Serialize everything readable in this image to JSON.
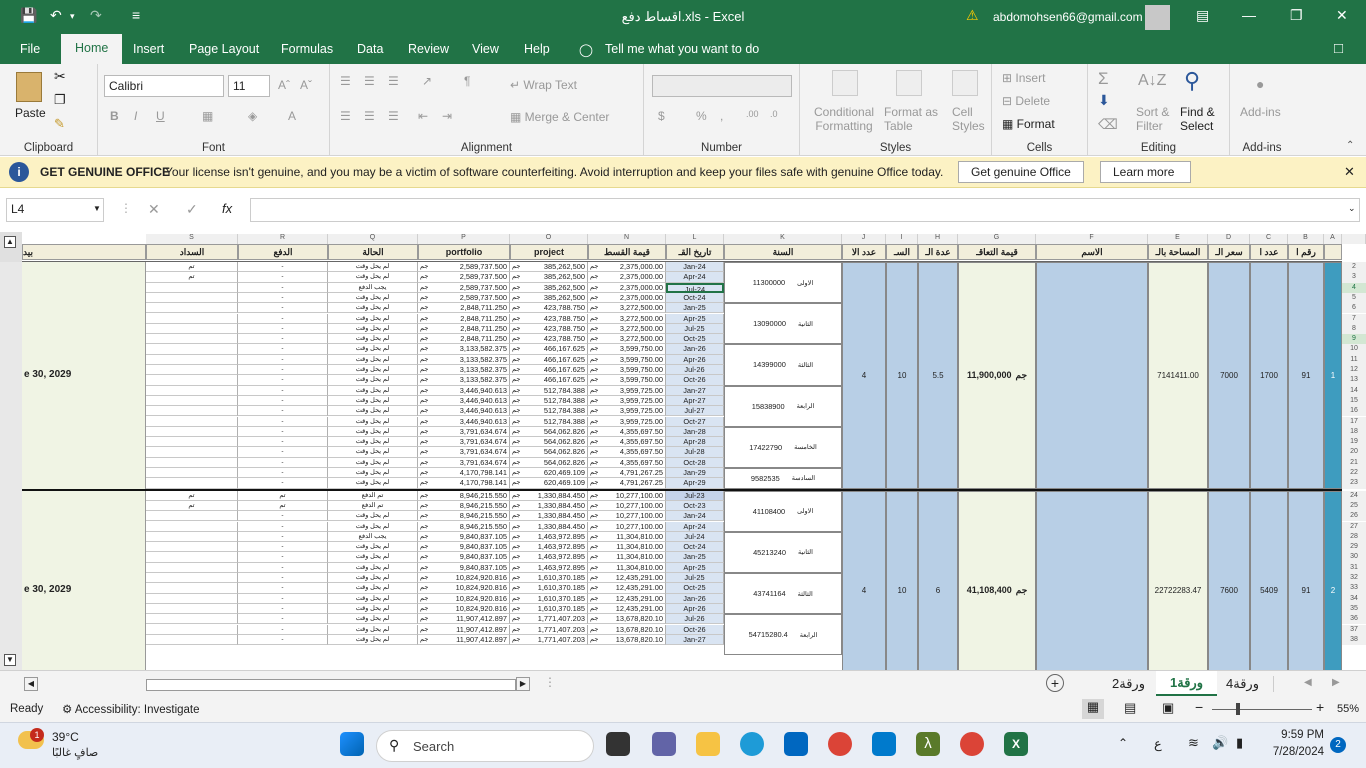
{
  "titlebar": {
    "filename": "اقساط دفع.xls",
    "app": "Excel",
    "separator": " - ",
    "account": "abdomohsen66@gmail.com"
  },
  "tabs": [
    "File",
    "Home",
    "Insert",
    "Page Layout",
    "Formulas",
    "Data",
    "Review",
    "View",
    "Help"
  ],
  "tellme": "Tell me what you want to do",
  "ribbon": {
    "clipboard": {
      "paste": "Paste",
      "label": "Clipboard"
    },
    "font": {
      "name": "Calibri",
      "size": "11",
      "label": "Font"
    },
    "alignment": {
      "wrap": "Wrap Text",
      "merge": "Merge & Center",
      "label": "Alignment"
    },
    "number": {
      "label": "Number"
    },
    "styles": {
      "cond": "Conditional",
      "cond2": "Formatting",
      "fmt": "Format as",
      "fmt2": "Table",
      "cell": "Cell",
      "cell2": "Styles",
      "label": "Styles"
    },
    "cells": {
      "insert": "Insert",
      "delete": "Delete",
      "format": "Format",
      "label": "Cells"
    },
    "editing": {
      "sort": "Sort &",
      "sort2": "Filter",
      "find": "Find &",
      "find2": "Select",
      "label": "Editing"
    },
    "addins": {
      "btn": "Add-ins",
      "label": "Add-ins"
    }
  },
  "message": {
    "title": "GET GENUINE OFFICE",
    "text": "Your license isn't genuine, and you may be a victim of software counterfeiting. Avoid interruption and keep your files safe with genuine Office today.",
    "btn1": "Get genuine Office",
    "btn2": "Learn more"
  },
  "namebox": "L4",
  "columns": [
    {
      "letter": "S",
      "header": "السداد"
    },
    {
      "letter": "R",
      "header": "الدفع"
    },
    {
      "letter": "Q",
      "header": "الحالة"
    },
    {
      "letter": "P",
      "header": "portfolio"
    },
    {
      "letter": "O",
      "header": "project"
    },
    {
      "letter": "N",
      "header": "قيمة القسط"
    },
    {
      "letter": "L",
      "header": "تاريخ القـ"
    },
    {
      "letter": "K",
      "header": "السنة"
    },
    {
      "letter": "J",
      "header": "عدد الا"
    },
    {
      "letter": "I",
      "header": "السـ"
    },
    {
      "letter": "H",
      "header": "عدة الـ"
    },
    {
      "letter": "G",
      "header": "قيمة التعاقـ"
    },
    {
      "letter": "F",
      "header": "الاسم"
    },
    {
      "letter": "E",
      "header": "المساحة بالـ"
    },
    {
      "letter": "D",
      "header": "سعر الـ"
    },
    {
      "letter": "C",
      "header": "عدد ا"
    },
    {
      "letter": "B",
      "header": "رقم ا"
    },
    {
      "letter": "A",
      "header": ""
    }
  ],
  "leftcol": {
    "header": "بيد",
    "date1": "e 30, 2029",
    "date2": "e 30, 2029"
  },
  "rows": [
    {
      "n": "2",
      "s": "تم",
      "r": "-",
      "q": "لم يحل وقت",
      "p": "2,589,737.500",
      "o": "385,262,500",
      "nn": "2,375,000.00",
      "l": "Jan-24"
    },
    {
      "n": "3",
      "s": "تم",
      "r": "-",
      "q": "لم يحل وقت",
      "p": "2,589,737.500",
      "o": "385,262,500",
      "nn": "2,375,000.00",
      "l": "Apr-24"
    },
    {
      "n": "4",
      "s": "",
      "r": "-",
      "q": "يجب الدفع",
      "p": "2,589,737.500",
      "o": "385,262,500",
      "nn": "2,375,000.00",
      "l": "Jul-24"
    },
    {
      "n": "5",
      "s": "",
      "r": "-",
      "q": "لم يحل وقت",
      "p": "2,589,737.500",
      "o": "385,262,500",
      "nn": "2,375,000.00",
      "l": "Oct-24"
    },
    {
      "n": "6",
      "s": "",
      "r": "-",
      "q": "لم يحل وقت",
      "p": "2,848,711.250",
      "o": "423,788.750",
      "nn": "3,272,500.00",
      "l": "Jan-25"
    },
    {
      "n": "7",
      "s": "",
      "r": "-",
      "q": "لم يحل وقت",
      "p": "2,848,711.250",
      "o": "423,788.750",
      "nn": "3,272,500.00",
      "l": "Apr-25"
    },
    {
      "n": "8",
      "s": "",
      "r": "-",
      "q": "لم يحل وقت",
      "p": "2,848,711.250",
      "o": "423,788.750",
      "nn": "3,272,500.00",
      "l": "Jul-25"
    },
    {
      "n": "9",
      "s": "",
      "r": "-",
      "q": "لم يحل وقت",
      "p": "2,848,711.250",
      "o": "423,788.750",
      "nn": "3,272,500.00",
      "l": "Oct-25"
    },
    {
      "n": "10",
      "s": "",
      "r": "-",
      "q": "لم يحل وقت",
      "p": "3,133,582.375",
      "o": "466,167.625",
      "nn": "3,599,750.00",
      "l": "Jan-26"
    },
    {
      "n": "11",
      "s": "",
      "r": "-",
      "q": "لم يحل وقت",
      "p": "3,133,582.375",
      "o": "466,167.625",
      "nn": "3,599,750.00",
      "l": "Apr-26"
    },
    {
      "n": "12",
      "s": "",
      "r": "-",
      "q": "لم يحل وقت",
      "p": "3,133,582.375",
      "o": "466,167.625",
      "nn": "3,599,750.00",
      "l": "Jul-26"
    },
    {
      "n": "13",
      "s": "",
      "r": "-",
      "q": "لم يحل وقت",
      "p": "3,133,582.375",
      "o": "466,167.625",
      "nn": "3,599,750.00",
      "l": "Oct-26"
    },
    {
      "n": "14",
      "s": "",
      "r": "-",
      "q": "لم يحل وقت",
      "p": "3,446,940.613",
      "o": "512,784.388",
      "nn": "3,959,725.00",
      "l": "Jan-27"
    },
    {
      "n": "15",
      "s": "",
      "r": "-",
      "q": "لم يحل وقت",
      "p": "3,446,940.613",
      "o": "512,784.388",
      "nn": "3,959,725.00",
      "l": "Apr-27"
    },
    {
      "n": "16",
      "s": "",
      "r": "-",
      "q": "لم يحل وقت",
      "p": "3,446,940.613",
      "o": "512,784.388",
      "nn": "3,959,725.00",
      "l": "Jul-27"
    },
    {
      "n": "17",
      "s": "",
      "r": "-",
      "q": "لم يحل وقت",
      "p": "3,446,940.613",
      "o": "512,784.388",
      "nn": "3,959,725.00",
      "l": "Oct-27"
    },
    {
      "n": "18",
      "s": "",
      "r": "-",
      "q": "لم يحل وقت",
      "p": "3,791,634.674",
      "o": "564,062.826",
      "nn": "4,355,697.50",
      "l": "Jan-28"
    },
    {
      "n": "19",
      "s": "",
      "r": "-",
      "q": "لم يحل وقت",
      "p": "3,791,634.674",
      "o": "564,062.826",
      "nn": "4,355,697.50",
      "l": "Apr-28"
    },
    {
      "n": "20",
      "s": "",
      "r": "-",
      "q": "لم يحل وقت",
      "p": "3,791,634.674",
      "o": "564,062.826",
      "nn": "4,355,697.50",
      "l": "Jul-28"
    },
    {
      "n": "21",
      "s": "",
      "r": "-",
      "q": "لم يحل وقت",
      "p": "3,791,634.674",
      "o": "564,062.826",
      "nn": "4,355,697.50",
      "l": "Oct-28"
    },
    {
      "n": "22",
      "s": "",
      "r": "-",
      "q": "لم يحل وقت",
      "p": "4,170,798.141",
      "o": "620,469.109",
      "nn": "4,791,267.25",
      "l": "Jan-29"
    },
    {
      "n": "23",
      "s": "",
      "r": "-",
      "q": "لم يحل وقت",
      "p": "4,170,798.141",
      "o": "620,469.109",
      "nn": "4,791,267.25",
      "l": "Apr-29"
    },
    {
      "n": "24",
      "s": "تم",
      "r": "تم",
      "q": "تم الدفع",
      "p": "8,946,215.550",
      "o": "1,330,884.450",
      "nn": "10,277,100.00",
      "l": "Jul-23"
    },
    {
      "n": "25",
      "s": "تم",
      "r": "تم",
      "q": "تم الدفع",
      "p": "8,946,215.550",
      "o": "1,330,884.450",
      "nn": "10,277,100.00",
      "l": "Oct-23"
    },
    {
      "n": "26",
      "s": "",
      "r": "-",
      "q": "لم يحل وقت",
      "p": "8,946,215.550",
      "o": "1,330,884.450",
      "nn": "10,277,100.00",
      "l": "Jan-24"
    },
    {
      "n": "27",
      "s": "",
      "r": "-",
      "q": "لم يحل وقت",
      "p": "8,946,215.550",
      "o": "1,330,884.450",
      "nn": "10,277,100.00",
      "l": "Apr-24"
    },
    {
      "n": "28",
      "s": "",
      "r": "-",
      "q": "يجب الدفع",
      "p": "9,840,837.105",
      "o": "1,463,972.895",
      "nn": "11,304,810.00",
      "l": "Jul-24"
    },
    {
      "n": "29",
      "s": "",
      "r": "-",
      "q": "لم يحل وقت",
      "p": "9,840,837.105",
      "o": "1,463,972.895",
      "nn": "11,304,810.00",
      "l": "Oct-24"
    },
    {
      "n": "30",
      "s": "",
      "r": "-",
      "q": "لم يحل وقت",
      "p": "9,840,837.105",
      "o": "1,463,972.895",
      "nn": "11,304,810.00",
      "l": "Jan-25"
    },
    {
      "n": "31",
      "s": "",
      "r": "-",
      "q": "لم يحل وقت",
      "p": "9,840,837.105",
      "o": "1,463,972.895",
      "nn": "11,304,810.00",
      "l": "Apr-25"
    },
    {
      "n": "32",
      "s": "",
      "r": "-",
      "q": "لم يحل وقت",
      "p": "10,824,920.816",
      "o": "1,610,370.185",
      "nn": "12,435,291.00",
      "l": "Jul-25"
    },
    {
      "n": "33",
      "s": "",
      "r": "-",
      "q": "لم يحل وقت",
      "p": "10,824,920.816",
      "o": "1,610,370.185",
      "nn": "12,435,291.00",
      "l": "Oct-25"
    },
    {
      "n": "34",
      "s": "",
      "r": "-",
      "q": "لم يحل وقت",
      "p": "10,824,920.816",
      "o": "1,610,370.185",
      "nn": "12,435,291.00",
      "l": "Jan-26"
    },
    {
      "n": "35",
      "s": "",
      "r": "-",
      "q": "لم يحل وقت",
      "p": "10,824,920.816",
      "o": "1,610,370.185",
      "nn": "12,435,291.00",
      "l": "Apr-26"
    },
    {
      "n": "36",
      "s": "",
      "r": "-",
      "q": "لم يحل وقت",
      "p": "11,907,412.897",
      "o": "1,771,407.203",
      "nn": "13,678,820.10",
      "l": "Jul-26"
    },
    {
      "n": "37",
      "s": "",
      "r": "-",
      "q": "لم يحل وقت",
      "p": "11,907,412.897",
      "o": "1,771,407.203",
      "nn": "13,678,820.10",
      "l": "Oct-26"
    },
    {
      "n": "38",
      "s": "",
      "r": "-",
      "q": "لم يحل وقت",
      "p": "11,907,412.897",
      "o": "1,771,407.203",
      "nn": "13,678,820.10",
      "l": "Jan-27"
    }
  ],
  "currency": "جم",
  "years1": [
    {
      "name": "الاولى",
      "val": "11300000"
    },
    {
      "name": "الثانية",
      "val": "13090000"
    },
    {
      "name": "الثالثة",
      "val": "14399000"
    },
    {
      "name": "الرابعة",
      "val": "15838900"
    },
    {
      "name": "الخامسة",
      "val": "17422790"
    },
    {
      "name": "السادسة",
      "val": "9582535"
    }
  ],
  "years2": [
    {
      "name": "الاولى",
      "val": "41108400"
    },
    {
      "name": "الثانية",
      "val": "45213240"
    },
    {
      "name": "الثالثة",
      "val": "43741164"
    },
    {
      "name": "الرابعة",
      "val": "54715280.4"
    }
  ],
  "group1": {
    "j": "4",
    "i": "10",
    "h": "5.5",
    "g": "11,900,000",
    "e": "7141411.00",
    "d": "7000",
    "c": "1700",
    "b": "91",
    "a": "1"
  },
  "group2": {
    "j": "4",
    "i": "10",
    "h": "6",
    "g": "41,108,400",
    "e": "22722283.47",
    "d": "7600",
    "c": "5409",
    "b": "91",
    "a": "2"
  },
  "sheets": [
    "ورقة2",
    "ورقة1",
    "ورقة4"
  ],
  "status": {
    "ready": "Ready",
    "access": "Accessibility: Investigate",
    "zoom": "55%"
  },
  "taskbar": {
    "temp": "39°C",
    "weather": "صافٍ غالبًا",
    "search": "Search",
    "time": "9:59 PM",
    "date": "7/28/2024",
    "lang": "ع",
    "badge": "1",
    "notif": "2"
  }
}
